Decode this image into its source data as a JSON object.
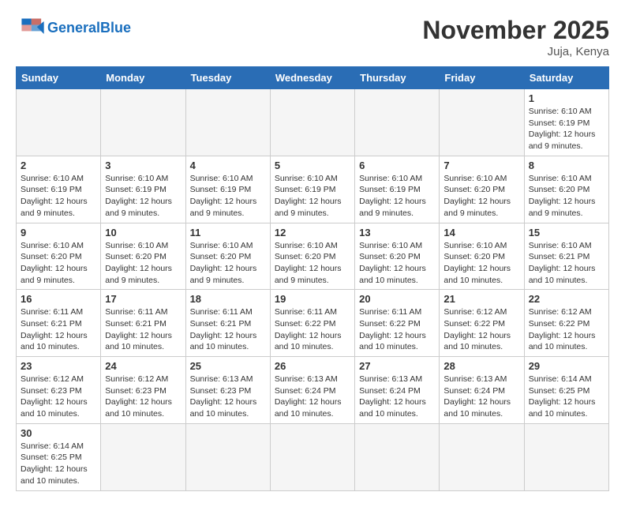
{
  "header": {
    "logo_general": "General",
    "logo_blue": "Blue",
    "month_title": "November 2025",
    "location": "Juja, Kenya"
  },
  "days_of_week": [
    "Sunday",
    "Monday",
    "Tuesday",
    "Wednesday",
    "Thursday",
    "Friday",
    "Saturday"
  ],
  "weeks": [
    [
      {
        "day": "",
        "info": ""
      },
      {
        "day": "",
        "info": ""
      },
      {
        "day": "",
        "info": ""
      },
      {
        "day": "",
        "info": ""
      },
      {
        "day": "",
        "info": ""
      },
      {
        "day": "",
        "info": ""
      },
      {
        "day": "1",
        "info": "Sunrise: 6:10 AM\nSunset: 6:19 PM\nDaylight: 12 hours\nand 9 minutes."
      }
    ],
    [
      {
        "day": "2",
        "info": "Sunrise: 6:10 AM\nSunset: 6:19 PM\nDaylight: 12 hours\nand 9 minutes."
      },
      {
        "day": "3",
        "info": "Sunrise: 6:10 AM\nSunset: 6:19 PM\nDaylight: 12 hours\nand 9 minutes."
      },
      {
        "day": "4",
        "info": "Sunrise: 6:10 AM\nSunset: 6:19 PM\nDaylight: 12 hours\nand 9 minutes."
      },
      {
        "day": "5",
        "info": "Sunrise: 6:10 AM\nSunset: 6:19 PM\nDaylight: 12 hours\nand 9 minutes."
      },
      {
        "day": "6",
        "info": "Sunrise: 6:10 AM\nSunset: 6:19 PM\nDaylight: 12 hours\nand 9 minutes."
      },
      {
        "day": "7",
        "info": "Sunrise: 6:10 AM\nSunset: 6:20 PM\nDaylight: 12 hours\nand 9 minutes."
      },
      {
        "day": "8",
        "info": "Sunrise: 6:10 AM\nSunset: 6:20 PM\nDaylight: 12 hours\nand 9 minutes."
      }
    ],
    [
      {
        "day": "9",
        "info": "Sunrise: 6:10 AM\nSunset: 6:20 PM\nDaylight: 12 hours\nand 9 minutes."
      },
      {
        "day": "10",
        "info": "Sunrise: 6:10 AM\nSunset: 6:20 PM\nDaylight: 12 hours\nand 9 minutes."
      },
      {
        "day": "11",
        "info": "Sunrise: 6:10 AM\nSunset: 6:20 PM\nDaylight: 12 hours\nand 9 minutes."
      },
      {
        "day": "12",
        "info": "Sunrise: 6:10 AM\nSunset: 6:20 PM\nDaylight: 12 hours\nand 9 minutes."
      },
      {
        "day": "13",
        "info": "Sunrise: 6:10 AM\nSunset: 6:20 PM\nDaylight: 12 hours\nand 10 minutes."
      },
      {
        "day": "14",
        "info": "Sunrise: 6:10 AM\nSunset: 6:20 PM\nDaylight: 12 hours\nand 10 minutes."
      },
      {
        "day": "15",
        "info": "Sunrise: 6:10 AM\nSunset: 6:21 PM\nDaylight: 12 hours\nand 10 minutes."
      }
    ],
    [
      {
        "day": "16",
        "info": "Sunrise: 6:11 AM\nSunset: 6:21 PM\nDaylight: 12 hours\nand 10 minutes."
      },
      {
        "day": "17",
        "info": "Sunrise: 6:11 AM\nSunset: 6:21 PM\nDaylight: 12 hours\nand 10 minutes."
      },
      {
        "day": "18",
        "info": "Sunrise: 6:11 AM\nSunset: 6:21 PM\nDaylight: 12 hours\nand 10 minutes."
      },
      {
        "day": "19",
        "info": "Sunrise: 6:11 AM\nSunset: 6:22 PM\nDaylight: 12 hours\nand 10 minutes."
      },
      {
        "day": "20",
        "info": "Sunrise: 6:11 AM\nSunset: 6:22 PM\nDaylight: 12 hours\nand 10 minutes."
      },
      {
        "day": "21",
        "info": "Sunrise: 6:12 AM\nSunset: 6:22 PM\nDaylight: 12 hours\nand 10 minutes."
      },
      {
        "day": "22",
        "info": "Sunrise: 6:12 AM\nSunset: 6:22 PM\nDaylight: 12 hours\nand 10 minutes."
      }
    ],
    [
      {
        "day": "23",
        "info": "Sunrise: 6:12 AM\nSunset: 6:23 PM\nDaylight: 12 hours\nand 10 minutes."
      },
      {
        "day": "24",
        "info": "Sunrise: 6:12 AM\nSunset: 6:23 PM\nDaylight: 12 hours\nand 10 minutes."
      },
      {
        "day": "25",
        "info": "Sunrise: 6:13 AM\nSunset: 6:23 PM\nDaylight: 12 hours\nand 10 minutes."
      },
      {
        "day": "26",
        "info": "Sunrise: 6:13 AM\nSunset: 6:24 PM\nDaylight: 12 hours\nand 10 minutes."
      },
      {
        "day": "27",
        "info": "Sunrise: 6:13 AM\nSunset: 6:24 PM\nDaylight: 12 hours\nand 10 minutes."
      },
      {
        "day": "28",
        "info": "Sunrise: 6:13 AM\nSunset: 6:24 PM\nDaylight: 12 hours\nand 10 minutes."
      },
      {
        "day": "29",
        "info": "Sunrise: 6:14 AM\nSunset: 6:25 PM\nDaylight: 12 hours\nand 10 minutes."
      }
    ],
    [
      {
        "day": "30",
        "info": "Sunrise: 6:14 AM\nSunset: 6:25 PM\nDaylight: 12 hours\nand 10 minutes."
      },
      {
        "day": "",
        "info": ""
      },
      {
        "day": "",
        "info": ""
      },
      {
        "day": "",
        "info": ""
      },
      {
        "day": "",
        "info": ""
      },
      {
        "day": "",
        "info": ""
      },
      {
        "day": "",
        "info": ""
      }
    ]
  ]
}
